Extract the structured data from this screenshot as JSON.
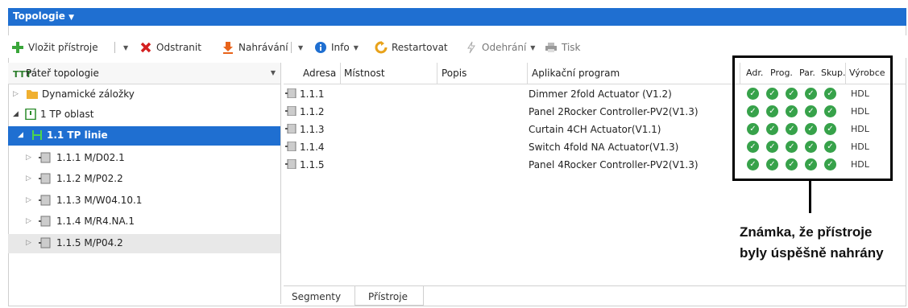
{
  "window": {
    "title": "Topologie"
  },
  "toolbar": {
    "insert_label": "Vložit přístroje",
    "remove_label": "Odstranit",
    "upload_label": "Nahrávání",
    "info_label": "Info",
    "restart_label": "Restartovat",
    "unload_label": "Odehrání",
    "print_label": "Tisk"
  },
  "tree": {
    "header": "Páteř topologie",
    "items": [
      {
        "label": "Dynamické záložky"
      },
      {
        "label": "1 TP oblast"
      },
      {
        "label": "1.1 TP linie"
      },
      {
        "label": "1.1.1 M/D02.1"
      },
      {
        "label": "1.1.2 M/P02.2"
      },
      {
        "label": "1.1.3 M/W04.10.1"
      },
      {
        "label": "1.1.4 M/R4.NA.1"
      },
      {
        "label": "1.1.5 M/P04.2"
      }
    ]
  },
  "grid": {
    "columns": {
      "address": "Adresa",
      "room": "Místnost",
      "description": "Popis",
      "app": "Aplikační program",
      "adr": "Adr.",
      "prog": "Prog.",
      "par": "Par.",
      "grp": "Skup.",
      "mfr": "Výrobce"
    },
    "rows": [
      {
        "address": "1.1.1",
        "app": "Dimmer 2fold Actuator (V1.2)",
        "mfr": "HDL"
      },
      {
        "address": "1.1.2",
        "app": "Panel 2Rocker Controller-PV2(V1.3)",
        "mfr": "HDL"
      },
      {
        "address": "1.1.3",
        "app": "Curtain 4CH Actuator(V1.1)",
        "mfr": "HDL"
      },
      {
        "address": "1.1.4",
        "app": "Switch 4fold NA Actuator(V1.3)",
        "mfr": "HDL"
      },
      {
        "address": "1.1.5",
        "app": "Panel 4Rocker Controller-PV2(V1.3)",
        "mfr": "HDL"
      }
    ]
  },
  "tabs": {
    "segments": "Segmenty",
    "devices": "Přístroje"
  },
  "annotation": {
    "line1": "Známka, že přístroje",
    "line2": "byly úspěšně nahrány"
  },
  "colors": {
    "accent": "#1f6fd1",
    "success": "#37a24a"
  }
}
